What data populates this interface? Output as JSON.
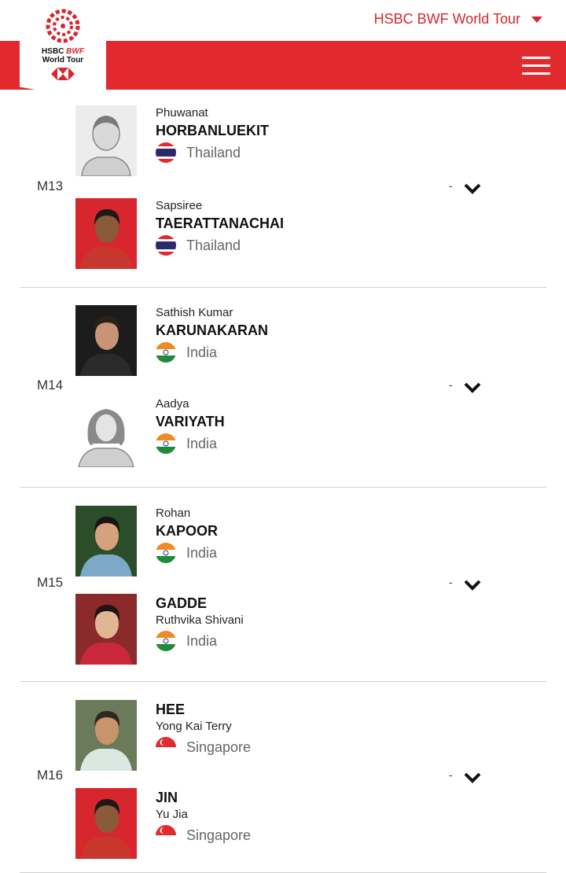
{
  "header": {
    "tour_selector": "HSBC BWF World Tour",
    "logo": {
      "line1": "HSBC",
      "line1_brand": "BWF",
      "line2": "World Tour"
    }
  },
  "colors": {
    "brand_red": "#e22a2e",
    "text_red": "#d7262e"
  },
  "matches": [
    {
      "code": "M13",
      "score": "-",
      "players": [
        {
          "line1": "Phuwanat",
          "name": "HORBANLUEKIT",
          "country": "Thailand",
          "flag": "thailand-flag",
          "photo": "placeholder-male"
        },
        {
          "line1": "Sapsiree",
          "name": "TAERATTANACHAI",
          "country": "Thailand",
          "flag": "thailand-flag",
          "photo": "player-photo"
        }
      ]
    },
    {
      "code": "M14",
      "score": "-",
      "players": [
        {
          "line1": "Sathish Kumar",
          "name": "KARUNAKARAN",
          "country": "India",
          "flag": "india-flag",
          "photo": "player-photo"
        },
        {
          "line1": "Aadya",
          "name": "VARIYATH",
          "country": "India",
          "flag": "india-flag",
          "photo": "placeholder-female"
        }
      ]
    },
    {
      "code": "M15",
      "score": "-",
      "players": [
        {
          "line1": "Rohan",
          "name": "KAPOOR",
          "country": "India",
          "flag": "india-flag",
          "photo": "player-photo"
        },
        {
          "name": "GADDE",
          "line2": "Ruthvika Shivani",
          "country": "India",
          "flag": "india-flag",
          "photo": "player-photo"
        }
      ]
    },
    {
      "code": "M16",
      "score": "-",
      "players": [
        {
          "name": "HEE",
          "line2": "Yong Kai Terry",
          "country": "Singapore",
          "flag": "singapore-flag",
          "photo": "player-photo"
        },
        {
          "name": "JIN",
          "line2": "Yu Jia",
          "country": "Singapore",
          "flag": "singapore-flag",
          "photo": "player-photo"
        }
      ]
    }
  ]
}
